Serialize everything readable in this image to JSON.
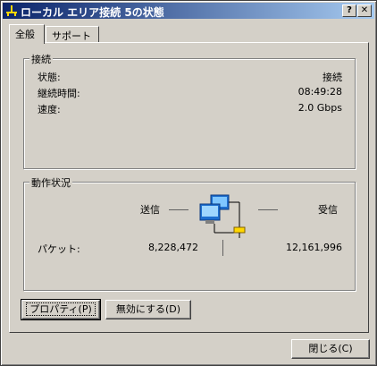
{
  "window": {
    "title": "ローカル エリア接続 5の状態",
    "help_label": "?",
    "close_label": "✕"
  },
  "tabs": [
    {
      "label": "全般",
      "active": true
    },
    {
      "label": "サポート",
      "active": false
    }
  ],
  "connection": {
    "group_label": "接続",
    "rows": [
      {
        "label": "状態:",
        "value": "接続"
      },
      {
        "label": "継続時間:",
        "value": "08:49:28"
      },
      {
        "label": "速度:",
        "value": "2.0 Gbps"
      }
    ]
  },
  "activity": {
    "group_label": "動作状況",
    "sent_label": "送信",
    "received_label": "受信",
    "packets_label": "パケット:",
    "packets_sent": "8,228,472",
    "packets_received": "12,161,996",
    "network_icon": "network-computers-icon"
  },
  "buttons": {
    "properties": "プロパティ(P)",
    "disable": "無効にする(D)",
    "close": "閉じる(C)"
  }
}
